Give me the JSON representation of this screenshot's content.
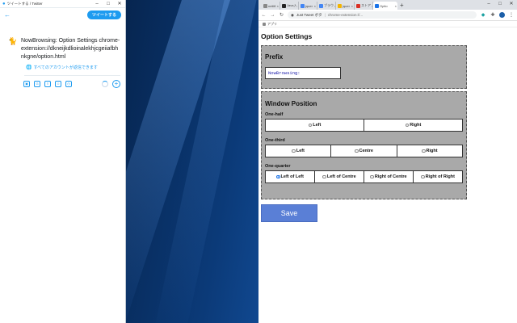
{
  "twitter": {
    "window_title": "ツイートする / Twitter",
    "tweet_button": "ツイートする",
    "tweet_text": "NowBrowsing: Option Settings chrome-extension://dkneijkdlioinalekhjcgeiiafbhnkgne/option.html",
    "reply_setting": "すべてのアカウントが返信できます",
    "icons": [
      "image-icon",
      "gif-icon",
      "poll-icon",
      "emoji-icon",
      "schedule-icon"
    ]
  },
  "chrome": {
    "tabs": [
      {
        "label": "netlifi",
        "color": "#888888"
      },
      {
        "label": "Java入",
        "color": "#222222"
      },
      {
        "label": "jquer",
        "color": "#4285f4"
      },
      {
        "label": "ブラウ",
        "color": "#4285f4"
      },
      {
        "label": "jquer",
        "color": "#f4b400"
      },
      {
        "label": "ストア",
        "color": "#d93025"
      },
      {
        "label": "Optio",
        "color": "#1a73e8",
        "active": true
      }
    ],
    "omnibox": {
      "label": "Just Tweet ボタ",
      "url": "chrome-extension://..."
    },
    "bookmark": "アプリ"
  },
  "page": {
    "title": "Option Settings",
    "prefix": {
      "heading": "Prefix",
      "value": "NowBrowsing:"
    },
    "window_position": {
      "heading": "Window Position",
      "groups": [
        {
          "label": "One-half",
          "options": [
            "Left",
            "Right"
          ],
          "selected": -1
        },
        {
          "label": "One-third",
          "options": [
            "Left",
            "Centre",
            "Right"
          ],
          "selected": -1
        },
        {
          "label": "One-quarter",
          "options": [
            "Left of Left",
            "Left of Centre",
            "Right of Centre",
            "Right of Right"
          ],
          "selected": 0
        }
      ]
    },
    "save_label": "Save"
  }
}
